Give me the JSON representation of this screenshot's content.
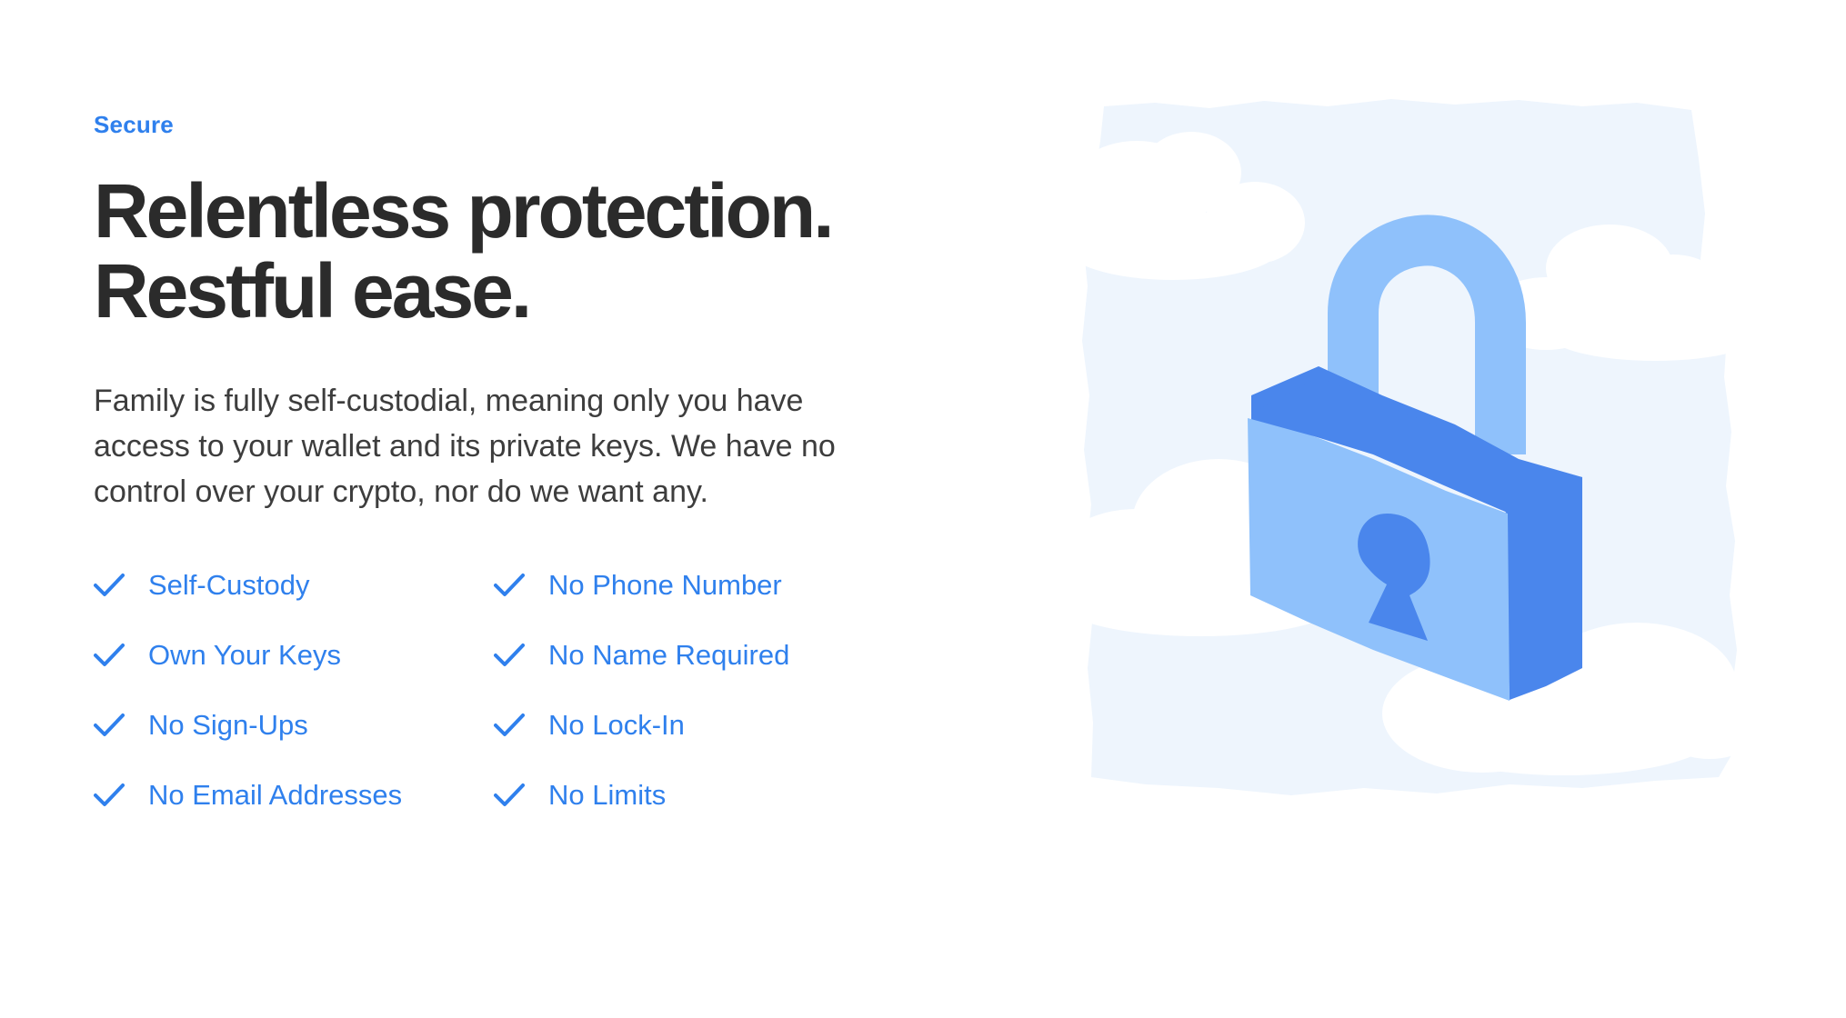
{
  "section": {
    "eyebrow": "Secure",
    "headline": {
      "line1": "Relentless protection.",
      "line2": "Restful ease."
    },
    "description": "Family is fully self-custodial, meaning only you have access to your wallet and its private keys. We have no control over your crypto, nor do we want any."
  },
  "features": {
    "left": [
      {
        "label": "Self-Custody",
        "icon": "check-icon"
      },
      {
        "label": "Own Your Keys",
        "icon": "check-icon"
      },
      {
        "label": "No Sign-Ups",
        "icon": "check-icon"
      },
      {
        "label": "No Email Addresses",
        "icon": "check-icon"
      }
    ],
    "right": [
      {
        "label": "No Phone Number",
        "icon": "check-icon"
      },
      {
        "label": "No Name Required",
        "icon": "check-icon"
      },
      {
        "label": "No Lock-In",
        "icon": "check-icon"
      },
      {
        "label": "No Limits",
        "icon": "check-icon"
      }
    ]
  },
  "illustration": {
    "icon": "padlock-in-clouds-illustration"
  },
  "colors": {
    "accent": "#2f80ed",
    "heading": "#2b2b2b",
    "body": "#3d3d3d",
    "sky": "#eef5fd",
    "lock_light": "#8fc1fb",
    "lock_dark": "#4a86ec"
  }
}
